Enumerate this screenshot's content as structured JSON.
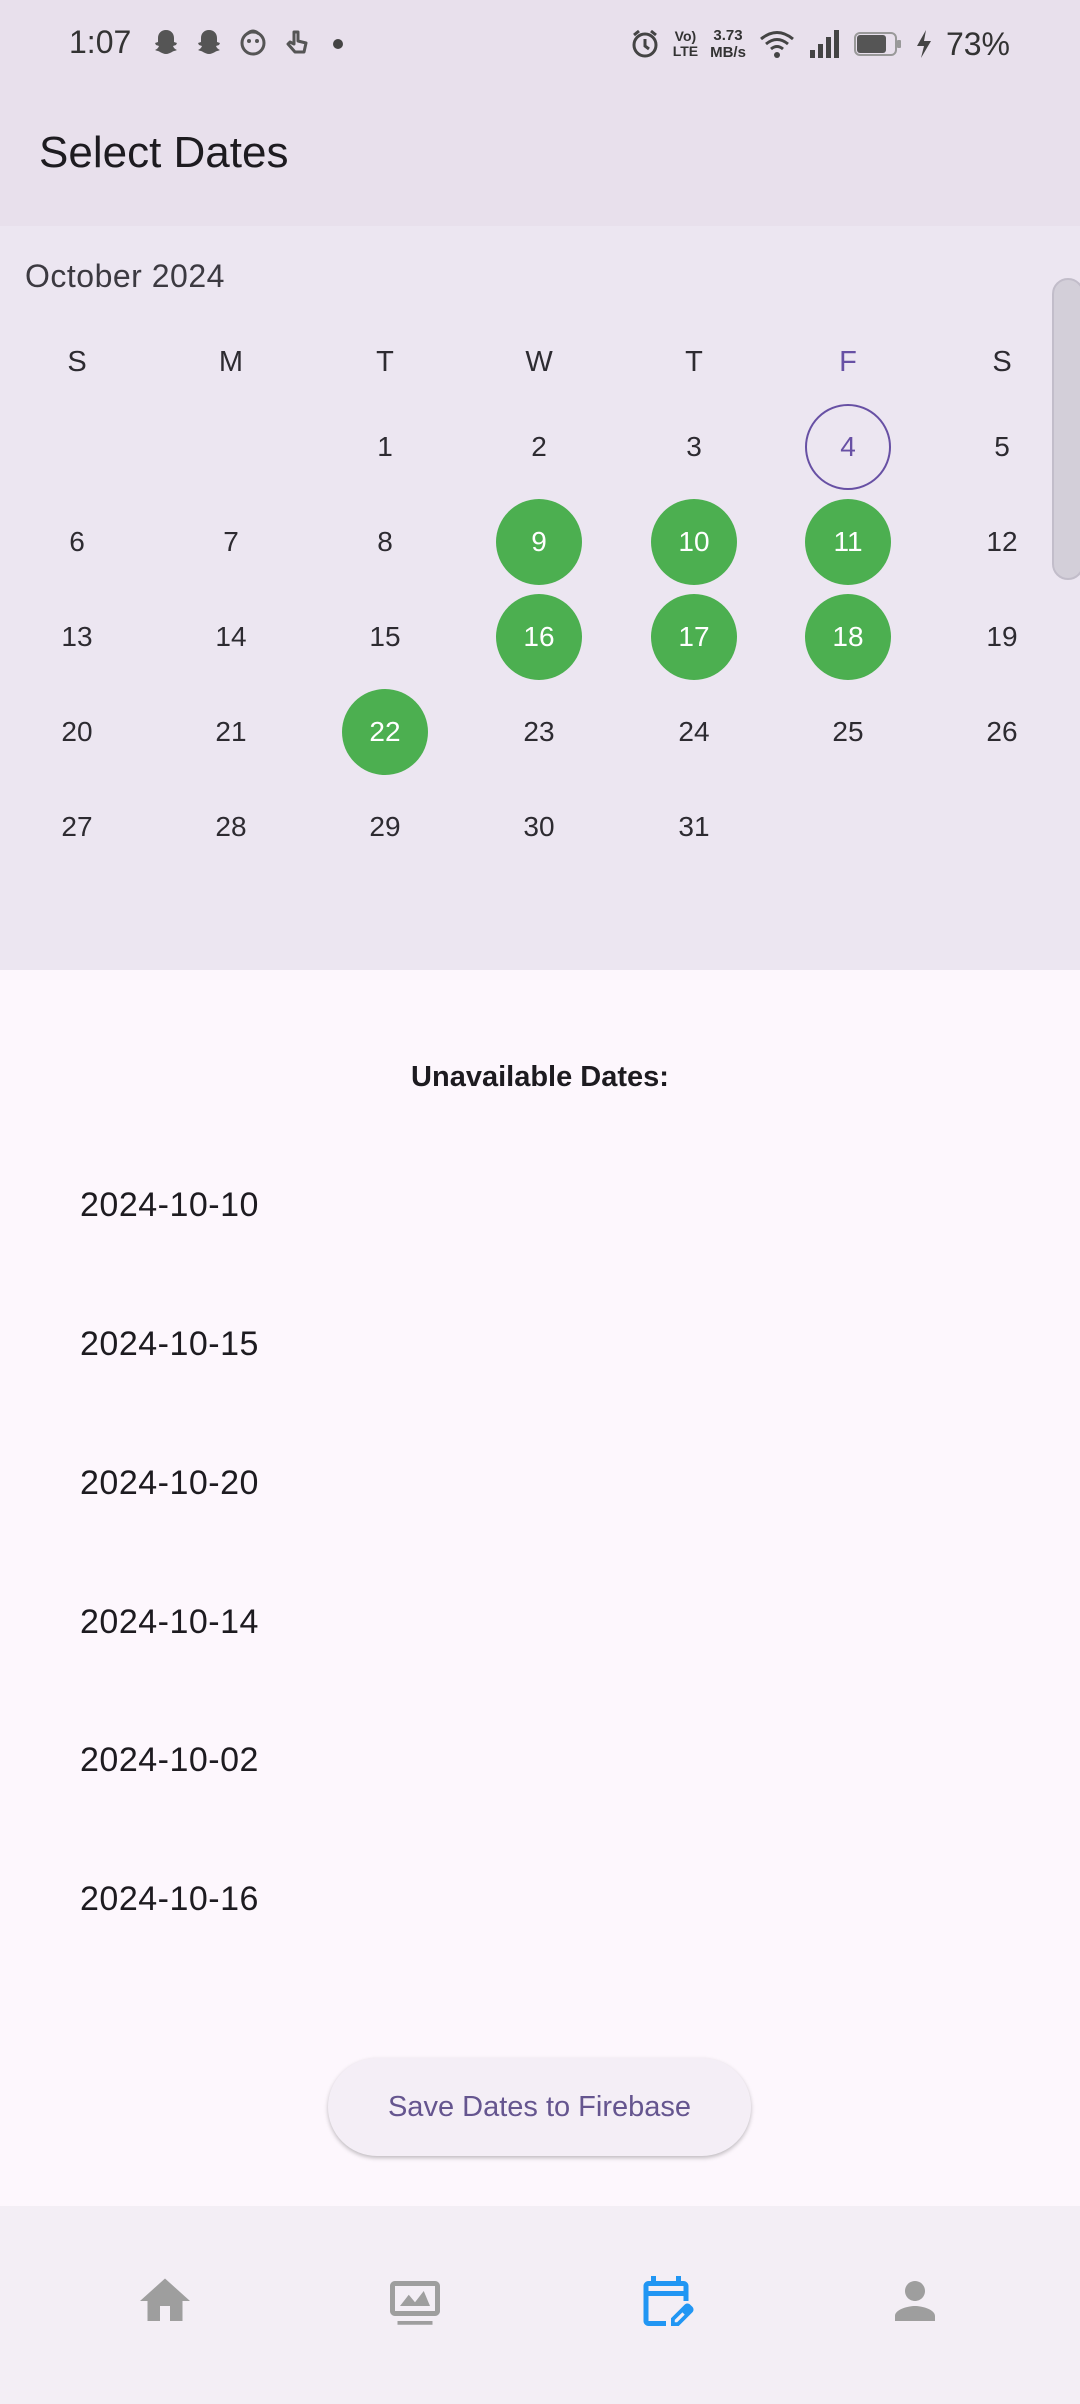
{
  "status_bar": {
    "time": "1:07",
    "network_speed_value": "3.73",
    "network_speed_unit": "MB/s",
    "volte_line1": "Vo)",
    "volte_line2": "LTE",
    "battery_percent": "73%"
  },
  "app_bar": {
    "title": "Select Dates"
  },
  "calendar": {
    "month_label": "October 2024",
    "weekdays": [
      "S",
      "M",
      "T",
      "W",
      "T",
      "F",
      "S"
    ],
    "today": 4,
    "selected_days": [
      9,
      10,
      11,
      16,
      17,
      18,
      22
    ],
    "days": [
      "1",
      "2",
      "3",
      "4",
      "5",
      "6",
      "7",
      "8",
      "9",
      "10",
      "11",
      "12",
      "13",
      "14",
      "15",
      "16",
      "17",
      "18",
      "19",
      "20",
      "21",
      "22",
      "23",
      "24",
      "25",
      "26",
      "27",
      "28",
      "29",
      "30",
      "31"
    ],
    "selected_color": "#4caf50",
    "today_color": "#6750a4"
  },
  "unavailable": {
    "title": "Unavailable Dates:",
    "dates": [
      "2024-10-10",
      "2024-10-15",
      "2024-10-20",
      "2024-10-14",
      "2024-10-02",
      "2024-10-16"
    ]
  },
  "save_button": {
    "label": "Save Dates to Firebase"
  },
  "bottom_nav": {
    "items": [
      {
        "icon": "home-icon",
        "active": false
      },
      {
        "icon": "image-icon",
        "active": false
      },
      {
        "icon": "calendar-edit-icon",
        "active": true
      },
      {
        "icon": "person-icon",
        "active": false
      }
    ],
    "active_color": "#2196f3",
    "inactive_color": "#9e9e9e"
  }
}
